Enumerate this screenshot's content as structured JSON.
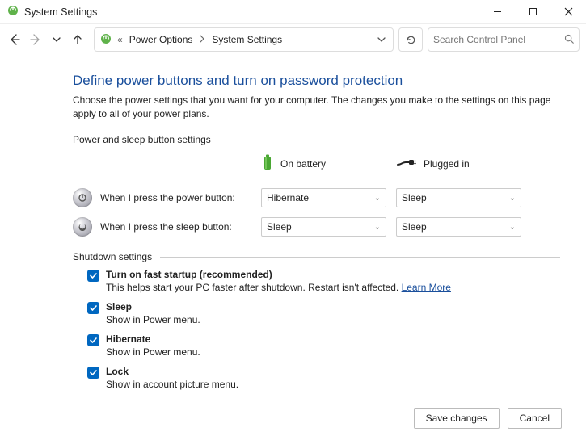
{
  "window": {
    "title": "System Settings"
  },
  "breadcrumb": {
    "chevron": "«",
    "items": [
      "Power Options",
      "System Settings"
    ]
  },
  "search": {
    "placeholder": "Search Control Panel"
  },
  "page": {
    "title": "Define power buttons and turn on password protection",
    "description": "Choose the power settings that you want for your computer. The changes you make to the settings on this page apply to all of your power plans."
  },
  "power_section": {
    "header": "Power and sleep button settings",
    "columns": {
      "battery": "On battery",
      "plugged": "Plugged in"
    },
    "rows": [
      {
        "label": "When I press the power button:",
        "battery": "Hibernate",
        "plugged": "Sleep"
      },
      {
        "label": "When I press the sleep button:",
        "battery": "Sleep",
        "plugged": "Sleep"
      }
    ]
  },
  "shutdown_section": {
    "header": "Shutdown settings",
    "items": [
      {
        "title": "Turn on fast startup (recommended)",
        "desc_prefix": "This helps start your PC faster after shutdown. Restart isn't affected. ",
        "link": "Learn More"
      },
      {
        "title": "Sleep",
        "desc": "Show in Power menu."
      },
      {
        "title": "Hibernate",
        "desc": "Show in Power menu."
      },
      {
        "title": "Lock",
        "desc": "Show in account picture menu."
      }
    ]
  },
  "footer": {
    "save": "Save changes",
    "cancel": "Cancel"
  }
}
